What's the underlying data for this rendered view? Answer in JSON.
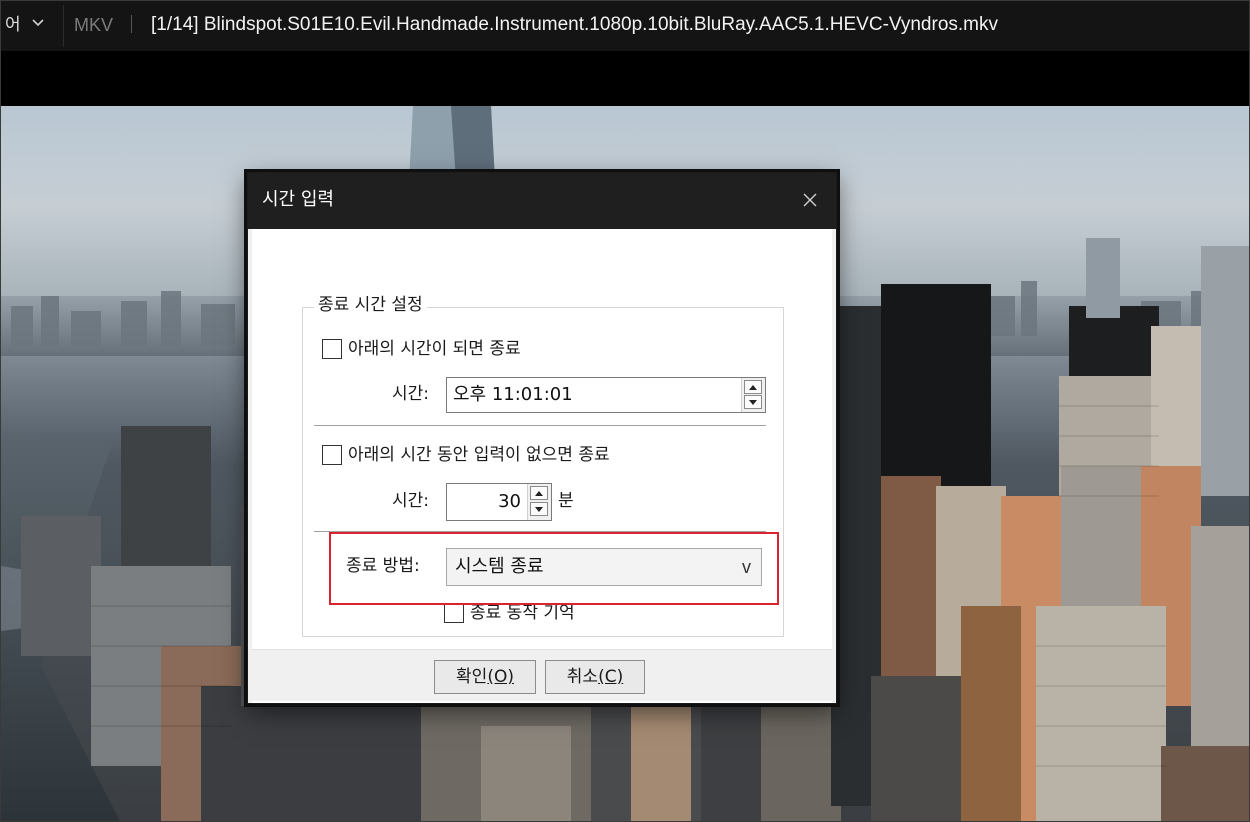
{
  "player": {
    "menu_label": "어",
    "format_label": "MKV",
    "separator": "|",
    "filename": "[1/14]  Blindspot.S01E10.Evil.Handmade.Instrument.1080p.10bit.BluRay.AAC5.1.HEVC-Vyndros.mkv"
  },
  "dialog": {
    "title": "시간 입력",
    "close_icon": "close-icon",
    "group_title": "종료 시간 설정",
    "section1": {
      "checkbox_label": "아래의 시간이 되면 종료",
      "checked": false,
      "time_label": "시간:",
      "time_value": "오후 11:01:01"
    },
    "section2": {
      "checkbox_label": "아래의 시간 동안 입력이 없으면 종료",
      "checked": false,
      "time_label": "시간:",
      "minutes_value": "30",
      "unit_label": "분"
    },
    "section3": {
      "method_label": "종료 방법:",
      "method_value": "시스템 종료",
      "dropdown_glyph": "v",
      "remember_label": "종료 동작 기억",
      "remember_checked": false
    },
    "buttons": {
      "ok_text": "확인",
      "ok_key": "(O)",
      "cancel_text": "취소",
      "cancel_key": "(C)"
    },
    "highlight_color": "#d9232e"
  }
}
